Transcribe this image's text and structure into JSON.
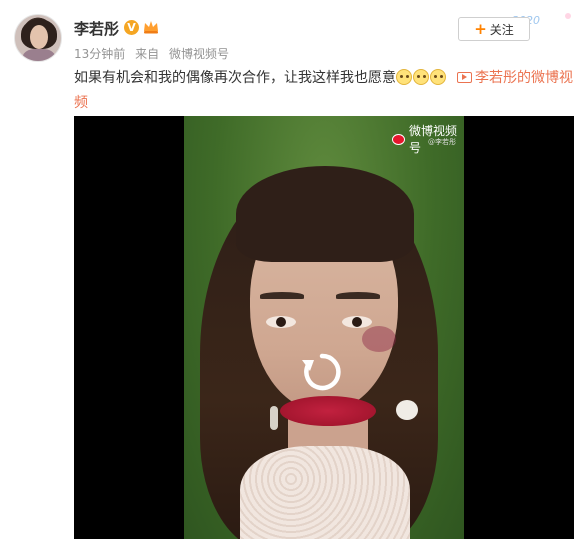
{
  "post": {
    "author_name": "李若彤",
    "verified_badge": "V",
    "time_ago": "13分钟前",
    "source_prefix": "来自",
    "source_name": "微博视频号",
    "text": "如果有机会和我的偶像再次合作，让我这样我也愿意",
    "emoji_count": 3,
    "emoji_name": "yun-emoji",
    "video_link_label": "李若彤的微博视频",
    "follow_label": "关注",
    "header_decoration_text": "2020"
  },
  "video": {
    "watermark_title": "微博视频号",
    "watermark_sub": "@李若彤",
    "replay_icon": "replay-icon",
    "state": "paused"
  },
  "colors": {
    "accent_orange": "#ff8200",
    "link_orange": "#eb7350",
    "meta_gray": "#939393",
    "lips_red": "#b81a36"
  }
}
